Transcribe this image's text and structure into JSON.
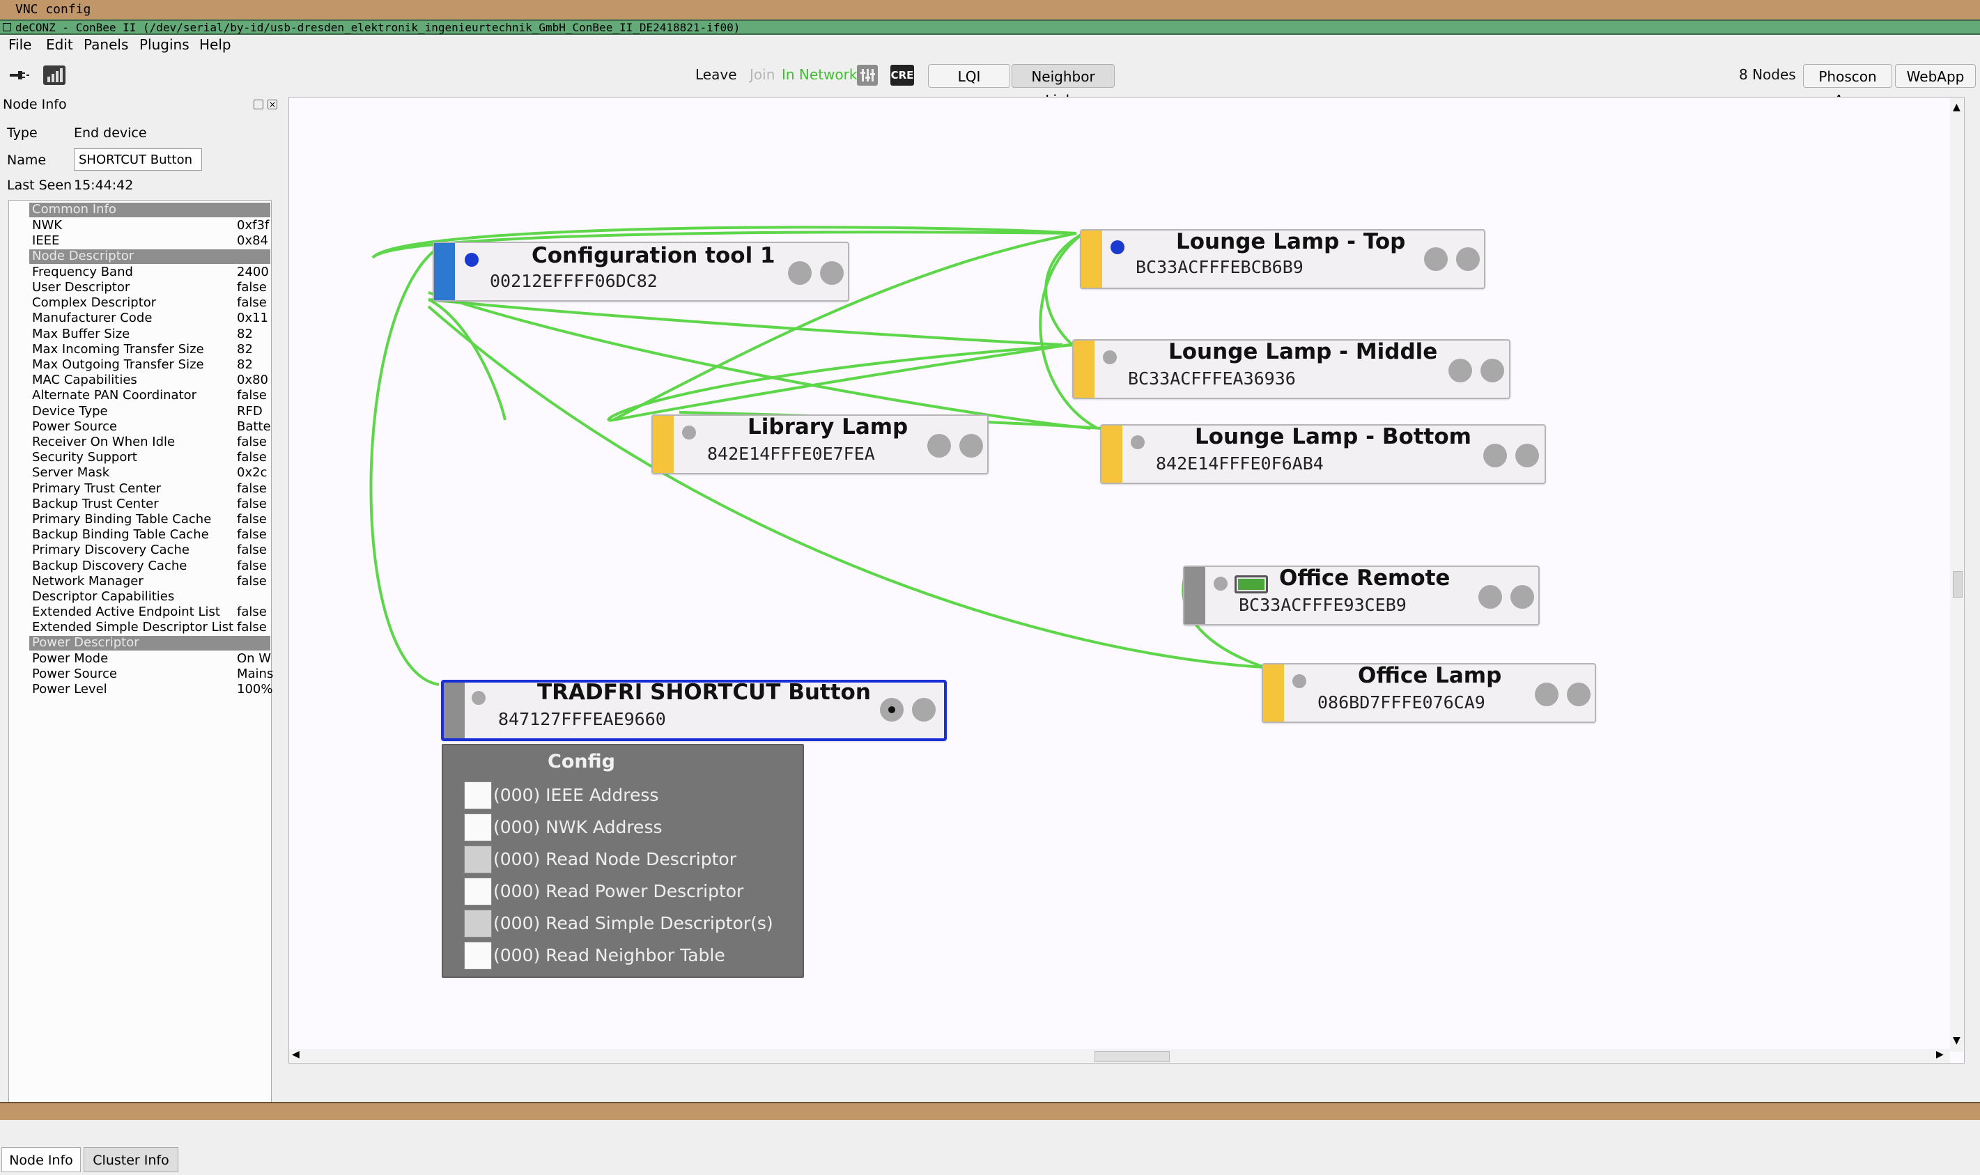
{
  "vnc_title": "VNC config",
  "window_title": "deCONZ - ConBee II (/dev/serial/by-id/usb-dresden_elektronik_ingenieurtechnik_GmbH_ConBee_II_DE2418821-if00)",
  "menu": [
    "File",
    "Edit",
    "Panels",
    "Plugins",
    "Help"
  ],
  "toolbar": {
    "leave": "Leave",
    "join": "Join",
    "status": "In Network",
    "cre": "CRE",
    "lqi": "LQI",
    "neighbor_links": "Neighbor Links",
    "nodes_count": "8 Nodes",
    "phoscon_app": "Phoscon App",
    "webapp": "WebApp",
    "status_color": "#3fbf2f"
  },
  "node_info": {
    "panel_title": "Node Info",
    "type_label": "Type",
    "type_value": "End device",
    "name_label": "Name",
    "name_value": "SHORTCUT Button",
    "last_seen_label": "Last Seen",
    "last_seen_value": "15:44:42",
    "sections": [
      {
        "title": "Common Info",
        "rows": [
          [
            "NWK",
            "0xf3f"
          ],
          [
            "IEEE",
            "0x84"
          ]
        ]
      },
      {
        "title": "Node Descriptor",
        "rows": [
          [
            "Frequency Band",
            "2400"
          ],
          [
            "User Descriptor",
            "false"
          ],
          [
            "Complex Descriptor",
            "false"
          ],
          [
            "Manufacturer Code",
            "0x11"
          ],
          [
            "Max Buffer Size",
            "82"
          ],
          [
            "Max Incoming Transfer Size",
            "82"
          ],
          [
            "Max Outgoing Transfer Size",
            "82"
          ],
          [
            "MAC Capabilities",
            "0x80"
          ],
          [
            "Alternate PAN Coordinator",
            "false"
          ],
          [
            "Device Type",
            "RFD"
          ],
          [
            "Power Source",
            "Batte"
          ],
          [
            "Receiver On When Idle",
            "false"
          ],
          [
            "Security Support",
            "false"
          ],
          [
            "Server Mask",
            "0x2c"
          ],
          [
            "Primary Trust Center",
            "false"
          ],
          [
            "Backup Trust Center",
            "false"
          ],
          [
            "Primary Binding Table Cache",
            "false"
          ],
          [
            "Backup Binding Table Cache",
            "false"
          ],
          [
            "Primary Discovery Cache",
            "false"
          ],
          [
            "Backup Discovery Cache",
            "false"
          ],
          [
            "Network Manager",
            "false"
          ],
          [
            "Descriptor Capabilities",
            ""
          ],
          [
            "Extended Active Endpoint List",
            "false"
          ],
          [
            "Extended Simple Descriptor List",
            "false"
          ]
        ]
      },
      {
        "title": "Power Descriptor",
        "rows": [
          [
            "Power Mode",
            "On W"
          ],
          [
            "Power Source",
            "Mains"
          ],
          [
            "Power Level",
            "100%"
          ]
        ]
      }
    ]
  },
  "tabs": {
    "node_info": "Node Info",
    "cluster_info": "Cluster Info"
  },
  "nodes": {
    "config_tool": {
      "name": "Configuration tool 1",
      "addr": "00212EFFFF06DC82"
    },
    "lamp_top": {
      "name": "Lounge Lamp - Top",
      "addr": "BC33ACFFFEBCB6B9"
    },
    "lamp_middle": {
      "name": "Lounge Lamp - Middle",
      "addr": "BC33ACFFFEA36936"
    },
    "library_lamp": {
      "name": "Library Lamp",
      "addr": "842E14FFFE0E7FEA"
    },
    "lamp_bottom": {
      "name": "Lounge Lamp - Bottom",
      "addr": "842E14FFFE0F6AB4"
    },
    "office_remote": {
      "name": "Office Remote",
      "addr": "BC33ACFFFE93CEB9"
    },
    "office_lamp": {
      "name": "Office Lamp",
      "addr": "086BD7FFFE076CA9"
    },
    "tradfri": {
      "name": "TRADFRI SHORTCUT Button",
      "addr": "847127FFFEAE9660"
    }
  },
  "config_panel": {
    "title": "Config",
    "items": [
      "(000) IEEE Address",
      "(000) NWK Address",
      "(000) Read Node Descriptor",
      "(000) Read Power Descriptor",
      "(000) Read Simple Descriptor(s)",
      "(000) Read Neighbor Table"
    ]
  },
  "colors": {
    "coordinator": "#2d78d0",
    "router": "#f5c43a",
    "end_device": "#8e8e8e",
    "link": "#5ed64a",
    "selected_border": "#1a2fd6"
  }
}
